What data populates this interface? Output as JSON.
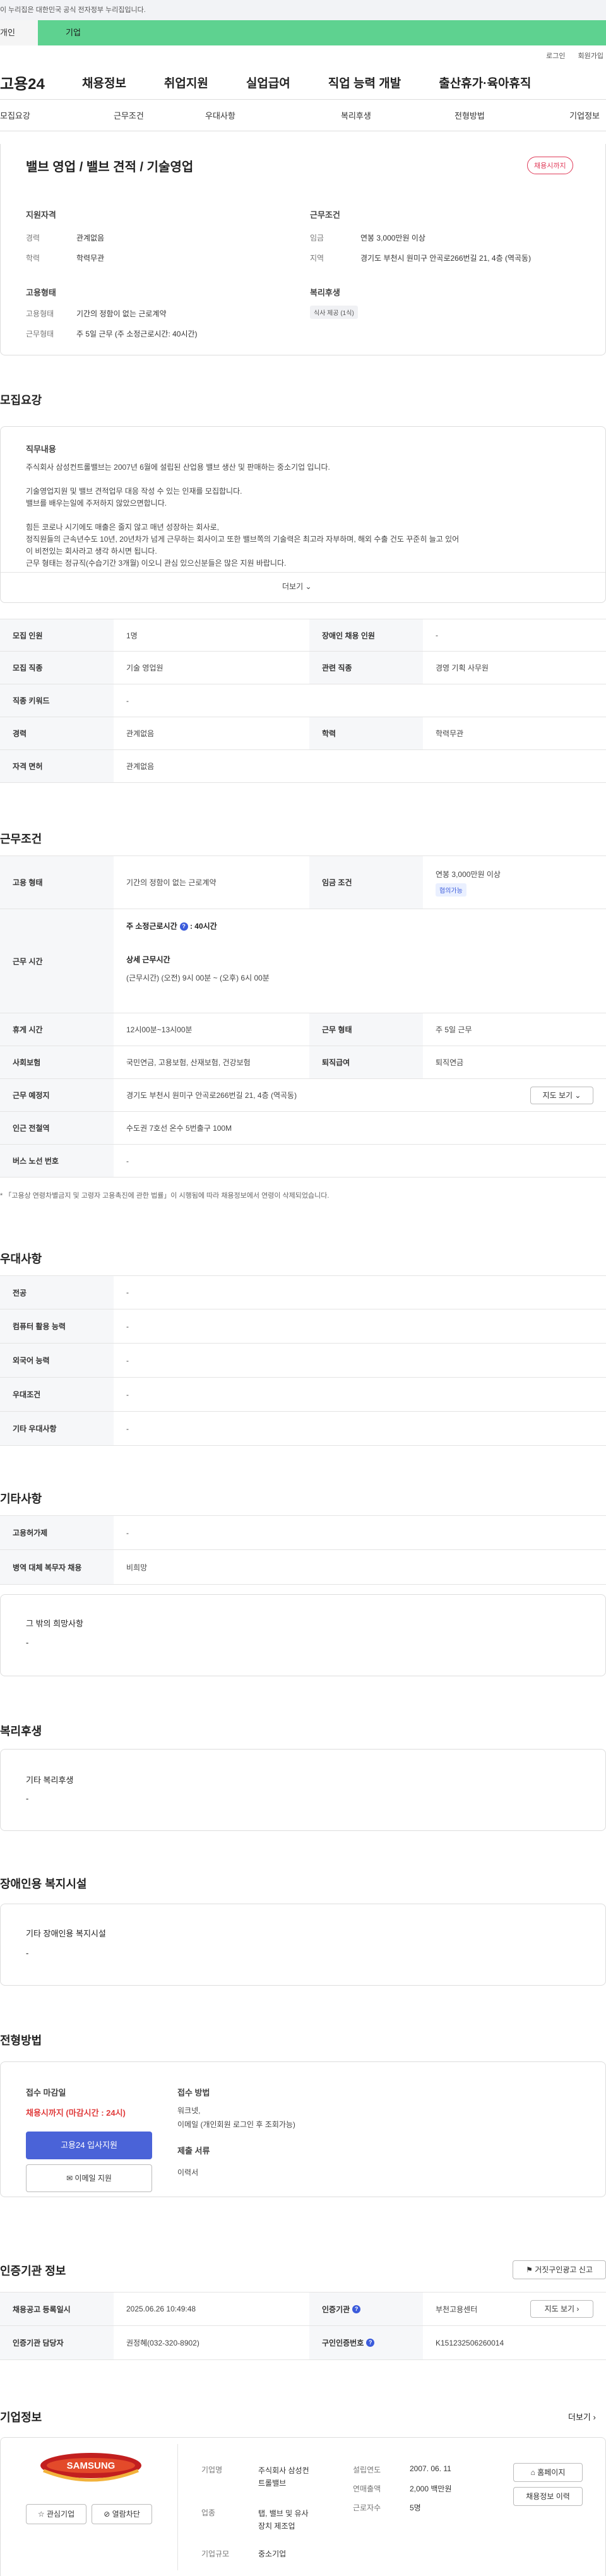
{
  "gov_banner": "이 누리집은 대한민국 공식 전자정부 누리집입니다.",
  "top_tabs": {
    "a": "개인",
    "b": "기업"
  },
  "util": {
    "login": "로그인",
    "signup": "회원가입"
  },
  "gnb": {
    "logo": "고용24",
    "items": [
      "채용정보",
      "취업지원",
      "실업급여",
      "직업 능력 개발",
      "출산휴가·육아휴직"
    ]
  },
  "subnav": [
    "모집요강",
    "근무조건",
    "우대사항",
    "복리후생",
    "전형방법",
    "기업정보"
  ],
  "summary": {
    "title": "밸브 영업 / 밸브 견적 / 기술영업",
    "badge": "채용시까지",
    "qualification_title": "지원자격",
    "work_title": "근무조건",
    "career_label": "경력",
    "career_value": "관계없음",
    "education_label": "학력",
    "education_value": "학력무관",
    "wage_label": "임금",
    "wage_value": "연봉 3,000만원 이상",
    "location_label": "지역",
    "location_value": "경기도 부천시 원미구 안곡로266번길 21, 4층 (역곡동)",
    "employ_title": "고용형태",
    "welfare_title": "복리후생",
    "employ_type_label": "고용형태",
    "employ_type_value": "기간의 정함이 없는 근로계약",
    "work_type_label": "근무형태",
    "work_type_value": "주 5일 근무 (주 소정근로시간: 40시간)",
    "welfare_tag": "식사 제공 (1식)"
  },
  "recruit": {
    "section_title": "모집요강",
    "job_content_title": "직무내용",
    "job_lines": [
      "주식회사 삼성컨트롤밸브는 2007년 6월에 설립된 산업용 밸브 생산 및 판매하는 중소기업 입니다.",
      "",
      "기술영업지원 및 밸브 견적업무 대응 작성 수 있는 인재를  모집합니다.",
      "밸브를 배우는일에 주저하지 않았으면합니다.",
      "",
      "힘든 코로나 시기에도 매출은 줄지 않고 매년 성장하는 회사로,",
      "정직원들의 근속년수도 10년, 20년차가 넘게  근무하는  회사이고 또한 밸브쪽의 기술력은 최고라 자부하며, 해외 수출 건도  꾸준히 늘고 있어",
      "이 비전있는 회사라고 생각 하시면 됩니다.",
      "근무 형태는 정규직(수습기간 3개월) 이오니 관심 있으신분들은 많은 지원 바랍니다."
    ],
    "more": "더보기",
    "rows": [
      {
        "l1": "모집 인원",
        "v1": "1명",
        "l2": "장애인 채용 인원",
        "v2": "-"
      },
      {
        "l1": "모집 직종",
        "v1": "기술 영업원",
        "l2": "관련 직종",
        "v2": "경영 기획 사무원"
      },
      {
        "l1": "직종 키워드",
        "v1": "-"
      },
      {
        "l1": "경력",
        "v1": "관계없음",
        "l2": "학력",
        "v2": "학력무관"
      },
      {
        "l1": "자격 면허",
        "v1": "관계없음"
      }
    ]
  },
  "conditions": {
    "section_title": "근무조건",
    "employ_label": "고용 형태",
    "employ_value": "기간의 정함이 없는 근로계약",
    "wage_label": "임금 조건",
    "wage_value": "연봉 3,000만원 이상",
    "wage_tag": "협의가능",
    "hours_label": "근무 시간",
    "weekly_hours": "주 소정근로시간",
    "weekly_hours_value": ": 40시간",
    "detail_title": "상세 근무시간",
    "detail_value": "(근무시간) (오전) 9시 00분 ~ (오후) 6시 00분",
    "break_label": "휴게 시간",
    "break_value": "12시00분~13시00분",
    "worktype_label": "근무 형태",
    "worktype_value": "주 5일 근무",
    "insurance_label": "사회보험",
    "insurance_value": "국민연금, 고용보험, 산재보험, 건강보험",
    "retire_label": "퇴직급여",
    "retire_value": "퇴직연금",
    "place_label": "근무 예정지",
    "place_value": "경기도 부천시 원미구 안곡로266번길 21, 4층 (역곡동)",
    "map_button": "지도 보기",
    "subway_label": "인근 전철역",
    "subway_value": "수도권 7호선 온수 5번출구 100M",
    "bus_label": "버스 노선 번호",
    "bus_value": "-",
    "note": "* 「고용상 연령차별금지 및 고령자 고용촉진에 관한 법률」이 시행됨에 따라 채용정보에서 연령이 삭제되었습니다."
  },
  "preference": {
    "section_title": "우대사항",
    "rows": [
      {
        "l": "전공",
        "v": "-"
      },
      {
        "l": "컴퓨터 활용 능력",
        "v": "-"
      },
      {
        "l": "외국어 능력",
        "v": "-"
      },
      {
        "l": "우대조건",
        "v": "-"
      },
      {
        "l": "기타 우대사항",
        "v": "-"
      }
    ]
  },
  "etc": {
    "section_title": "기타사항",
    "rows": [
      {
        "l": "고용허가제",
        "v": "-"
      },
      {
        "l": "병역 대체 복무자 채용",
        "v": "비희망"
      }
    ],
    "box_title": "그 밖의 희망사항",
    "box_value": "-"
  },
  "welfare": {
    "section_title": "복리후생",
    "box_title": "기타 복리후생",
    "box_value": "-"
  },
  "disability": {
    "section_title": "장애인용 복지시설",
    "box_title": "기타 장애인용 복지시설",
    "box_value": "-"
  },
  "selection": {
    "section_title": "전형방법",
    "deadline_title": "접수 마감일",
    "deadline_value": "채용시까지 (마감시간 : 24시)",
    "apply_button": "고용24 입사지원",
    "email_button": "이메일 지원",
    "method_title": "접수 방법",
    "method_value_1": "워크넷,",
    "method_value_2": "이메일 (개인회원 로그인 후 조회가능)",
    "docs_title": "제출 서류",
    "docs_value": "이력서"
  },
  "cert": {
    "section_title": "인증기관 정보",
    "report_button": "거짓구인광고 신고",
    "reg_label": "채용공고 등록일시",
    "reg_value": "2025.06.26 10:49:48",
    "org_label": "인증기관",
    "org_value": "부천고용센터",
    "map_button": "지도 보기",
    "manager_label": "인증기관 담당자",
    "manager_value": "권정혜(032-320-8902)",
    "num_label": "구인인증번호",
    "num_value": "K151232506260014"
  },
  "company": {
    "section_title": "기업정보",
    "more": "더보기",
    "logo_text": "SAMSUNG",
    "interest_button": "관심기업",
    "block_button": "열람차단",
    "name_label": "기업명",
    "name_value_1": "주식회사 삼성컨",
    "name_value_2": "트롤밸브",
    "industry_label": "업종",
    "industry_value_1": "탭, 밸브 및 유사",
    "industry_value_2": "장치 제조업",
    "size_label": "기업규모",
    "size_value": "중소기업",
    "founded_label": "설립연도",
    "founded_value": "2007. 06. 11",
    "sales_label": "연매출액",
    "sales_value": "2,000 백만원",
    "employees_label": "근로자수",
    "employees_value": "5명",
    "home_button": "홈페이지",
    "jobs_button": "채용정보 이력"
  }
}
